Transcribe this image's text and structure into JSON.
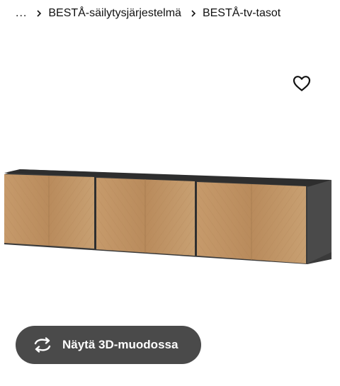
{
  "breadcrumb": {
    "ellipsis": "...",
    "items": [
      {
        "label": "BESTÅ-säilytysjärjestelmä"
      },
      {
        "label": "BESTÅ-tv-tasot"
      }
    ]
  },
  "favorite": {
    "icon": "heart-outline-icon"
  },
  "product": {
    "image_icon": "tv-bench-image"
  },
  "view3d": {
    "label": "Näytä 3D-muodossa",
    "icon": "rotate-3d-icon",
    "background": "#4a4a4a"
  }
}
